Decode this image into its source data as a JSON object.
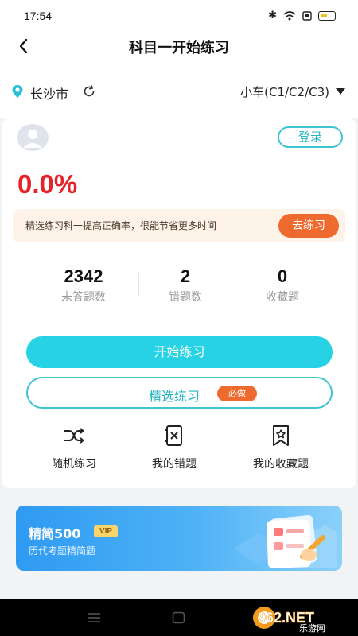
{
  "status_bar": {
    "time": "17:54"
  },
  "nav": {
    "title": "科目一开始练习"
  },
  "location": {
    "city": "长沙市",
    "car_type": "小车(C1/C2/C3)"
  },
  "card": {
    "login_label": "登录",
    "accuracy": "0.0%",
    "tip": {
      "text": "精选练习科一提高正确率，很能节省更多时间",
      "button": "去练习"
    },
    "stats": [
      {
        "value": "2342",
        "label": "未答题数"
      },
      {
        "value": "2",
        "label": "错题数"
      },
      {
        "value": "0",
        "label": "收藏题"
      }
    ],
    "start_button": "开始练习",
    "selected_button": "精选练习",
    "selected_badge": "必做",
    "quick": [
      {
        "label": "随机练习",
        "icon": "shuffle-icon"
      },
      {
        "label": "我的错题",
        "icon": "wrong-questions-icon"
      },
      {
        "label": "我的收藏题",
        "icon": "favorite-bookmark-icon"
      }
    ]
  },
  "promo": {
    "title": "精简500",
    "badge": "VIP",
    "subtitle": "历代考题精简题"
  },
  "watermark": {
    "text": "962.NET",
    "sub": "乐游网"
  }
}
